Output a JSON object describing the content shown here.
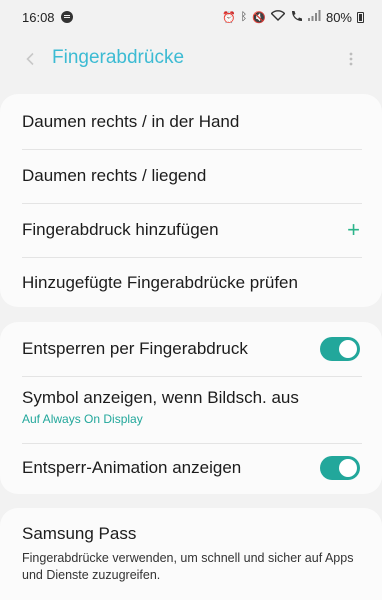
{
  "status_bar": {
    "time": "16:08",
    "battery": "80%",
    "icons": [
      "spotify-icon",
      "alarm-icon",
      "bluetooth-icon",
      "mute-icon",
      "wifi-icon",
      "wifi-call-icon",
      "signal-icon",
      "battery-icon"
    ]
  },
  "header": {
    "title": "Fingerabdrücke"
  },
  "fingerprints_card": {
    "items": [
      {
        "label": "Daumen rechts / in der Hand"
      },
      {
        "label": "Daumen rechts / liegend"
      },
      {
        "label": "Fingerabdruck hinzufügen"
      },
      {
        "label": "Hinzugefügte Fingerabdrücke prüfen"
      }
    ]
  },
  "settings_card": {
    "unlock": {
      "label": "Entsperren per Fingerabdruck",
      "enabled": true
    },
    "icon_screen_off": {
      "label": "Symbol anzeigen, wenn Bildsch. aus",
      "value": "Auf Always On Display"
    },
    "unlock_animation": {
      "label": "Entsperr-Animation anzeigen",
      "enabled": true
    }
  },
  "samsung_pass_card": {
    "title": "Samsung Pass",
    "description": "Fingerabdrücke verwenden, um schnell und sicher auf Apps und Dienste zuzugreifen."
  },
  "colors": {
    "accent": "#3cbbd3",
    "toggle_on": "#22a79b",
    "plus": "#2bb48a",
    "background": "#f2f2f2",
    "card": "#fbfbfb"
  }
}
